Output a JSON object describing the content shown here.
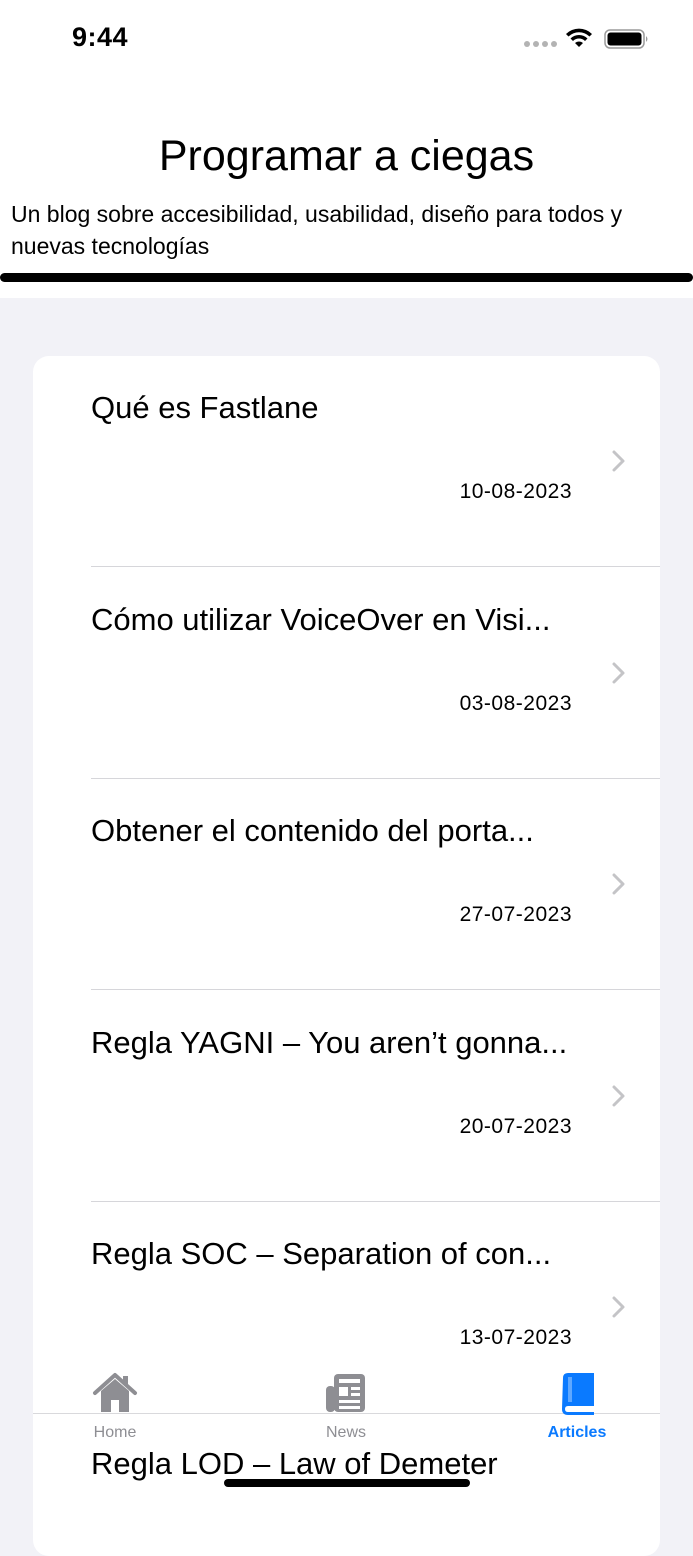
{
  "status_bar": {
    "time": "9:44",
    "icons": [
      "cellular-dots-icon",
      "wifi-icon",
      "battery-icon"
    ]
  },
  "header": {
    "title": "Programar a ciegas",
    "subtitle": "Un blog sobre accesibilidad, usabilidad, diseño para todos y nuevas tecnologías"
  },
  "articles": [
    {
      "title": "Qué es Fastlane",
      "date": "10-08-2023"
    },
    {
      "title": "Cómo utilizar VoiceOver en Visi...",
      "date": "03-08-2023"
    },
    {
      "title": "Obtener el contenido del porta...",
      "date": "27-07-2023"
    },
    {
      "title": "Regla YAGNI – You aren’t gonna...",
      "date": "20-07-2023"
    },
    {
      "title": "Regla SOC – Separation of con...",
      "date": "13-07-2023"
    },
    {
      "title": "Regla LOD – Law of Demeter"
    }
  ],
  "tab_bar": {
    "tabs": [
      {
        "label": "Home",
        "icon": "house-icon",
        "active": false
      },
      {
        "label": "News",
        "icon": "newspaper-icon",
        "active": false
      },
      {
        "label": "Articles",
        "icon": "book-icon",
        "active": true
      }
    ]
  },
  "colors": {
    "accent": "#0a7aff",
    "inactive_tab": "#8e8e93",
    "grouped_background": "#f2f2f7"
  }
}
